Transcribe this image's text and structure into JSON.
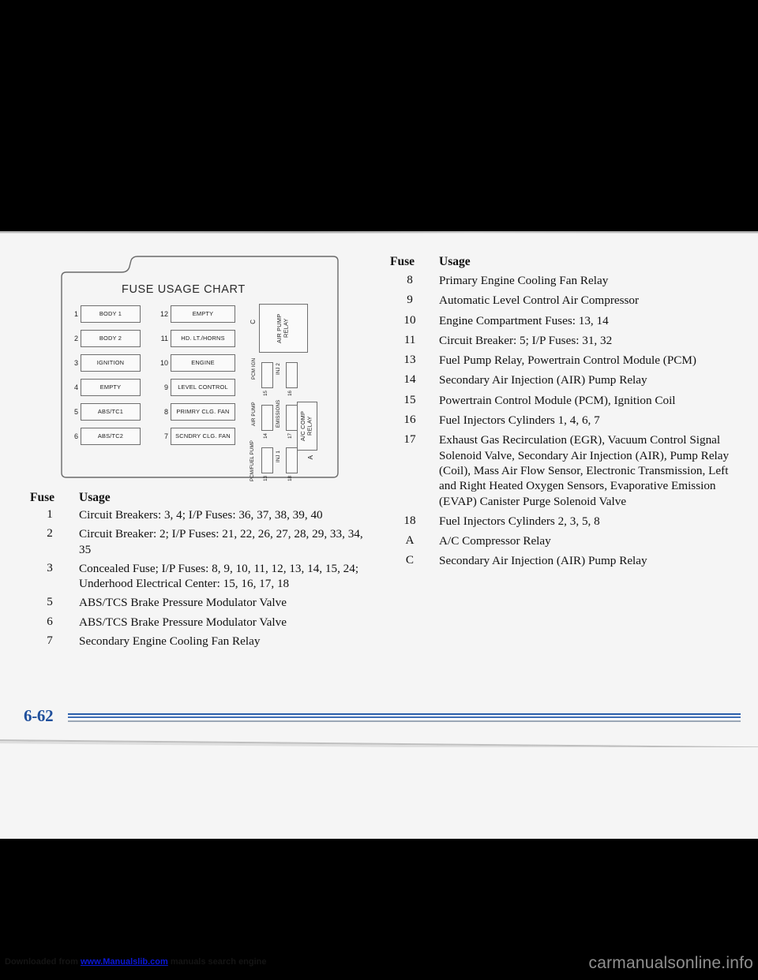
{
  "page": {
    "number": "6-62",
    "sheet_bg": "#f5f5f5",
    "accent_blue": "#2b5fab",
    "page_number_color": "#1f4f9c"
  },
  "diagram": {
    "title": "FUSE USAGE CHART",
    "left_column": [
      {
        "num": "1",
        "label": "BODY 1"
      },
      {
        "num": "2",
        "label": "BODY 2"
      },
      {
        "num": "3",
        "label": "IGNITION"
      },
      {
        "num": "4",
        "label": "EMPTY"
      },
      {
        "num": "5",
        "label": "ABS/TC1"
      },
      {
        "num": "6",
        "label": "ABS/TC2"
      }
    ],
    "middle_column": [
      {
        "num": "12",
        "label": "EMPTY"
      },
      {
        "num": "11",
        "label": "HD. LT./HORNS"
      },
      {
        "num": "10",
        "label": "ENGINE"
      },
      {
        "num": "9",
        "label": "LEVEL CONTROL"
      },
      {
        "num": "8",
        "label": "PRIMRY CLG. FAN"
      },
      {
        "num": "7",
        "label": "SCNDRY CLG. FAN"
      }
    ],
    "air_pump_relay": {
      "label": "AIR PUMP RELAY",
      "letter": "C"
    },
    "ac_comp_relay": {
      "label": "A/C COMP RELAY",
      "letter": "A"
    },
    "mini_fuses": [
      {
        "label": "PCM IGN",
        "num": "15"
      },
      {
        "label": "INJ 2",
        "num": "16"
      },
      {
        "label": "AIR PUMP",
        "num": "14"
      },
      {
        "label": "EMISSIONS",
        "num": "17"
      },
      {
        "label": "PCM/FUEL PUMP",
        "num": "13"
      },
      {
        "label": "INJ 1",
        "num": "18"
      }
    ]
  },
  "table_left": {
    "header": {
      "fuse": "Fuse",
      "usage": "Usage"
    },
    "rows": [
      {
        "fuse": "1",
        "usage": "Circuit Breakers: 3, 4; I/P Fuses: 36, 37, 38, 39, 40"
      },
      {
        "fuse": "2",
        "usage": "Circuit Breaker: 2; I/P Fuses: 21, 22, 26, 27, 28, 29, 33, 34, 35"
      },
      {
        "fuse": "3",
        "usage": "Concealed Fuse; I/P Fuses: 8, 9, 10, 11, 12, 13, 14, 15, 24; Underhood Electrical Center: 15, 16, 17, 18"
      },
      {
        "fuse": "5",
        "usage": "ABS/TCS Brake Pressure Modulator Valve"
      },
      {
        "fuse": "6",
        "usage": "ABS/TCS Brake Pressure Modulator Valve"
      },
      {
        "fuse": "7",
        "usage": "Secondary Engine Cooling Fan Relay"
      }
    ]
  },
  "table_right": {
    "header": {
      "fuse": "Fuse",
      "usage": "Usage"
    },
    "rows": [
      {
        "fuse": "8",
        "usage": "Primary Engine Cooling Fan Relay"
      },
      {
        "fuse": "9",
        "usage": "Automatic Level Control Air Compressor"
      },
      {
        "fuse": "10",
        "usage": "Engine Compartment Fuses: 13, 14"
      },
      {
        "fuse": "11",
        "usage": "Circuit Breaker: 5; I/P Fuses: 31, 32"
      },
      {
        "fuse": "13",
        "usage": "Fuel Pump Relay, Powertrain Control Module (PCM)"
      },
      {
        "fuse": "14",
        "usage": "Secondary Air Injection (AIR) Pump Relay"
      },
      {
        "fuse": "15",
        "usage": "Powertrain Control Module (PCM), Ignition Coil"
      },
      {
        "fuse": "16",
        "usage": "Fuel Injectors Cylinders 1, 4, 6, 7"
      },
      {
        "fuse": "17",
        "usage": "Exhaust Gas Recirculation (EGR), Vacuum Control Signal Solenoid Valve, Secondary Air Injection (AIR), Pump Relay (Coil), Mass Air Flow Sensor, Electronic Transmission, Left and Right Heated Oxygen Sensors, Evaporative Emission (EVAP) Canister Purge Solenoid Valve"
      },
      {
        "fuse": "18",
        "usage": "Fuel Injectors Cylinders 2, 3, 5, 8"
      },
      {
        "fuse": "A",
        "usage": "A/C Compressor Relay"
      },
      {
        "fuse": "C",
        "usage": "Secondary Air Injection (AIR) Pump Relay"
      }
    ]
  },
  "watermark": {
    "prefix": "Downloaded from ",
    "link": "www.Manualslib.com",
    "suffix": " manuals search engine",
    "brand": "carmanualsonline.info"
  }
}
